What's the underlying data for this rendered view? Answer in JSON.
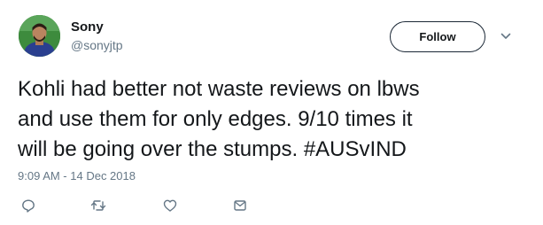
{
  "user": {
    "display_name": "Sony",
    "handle": "@sonyjtp",
    "avatar_icon": "user-avatar"
  },
  "follow_button": {
    "label": "Follow"
  },
  "menu": {
    "icon": "chevron-down-icon"
  },
  "tweet": {
    "text": "Kohli had better not waste reviews on lbws\nand use them for only edges. 9/10 times it\nwill be going over the stumps. #AUSvIND",
    "timestamp": "9:09 AM - 14 Dec 2018"
  },
  "actions": [
    {
      "icon": "reply-icon"
    },
    {
      "icon": "retweet-icon"
    },
    {
      "icon": "like-icon"
    },
    {
      "icon": "direct-message-icon"
    }
  ],
  "colors": {
    "text_primary": "#14171a",
    "text_secondary": "#657786",
    "icon": "#657786"
  }
}
